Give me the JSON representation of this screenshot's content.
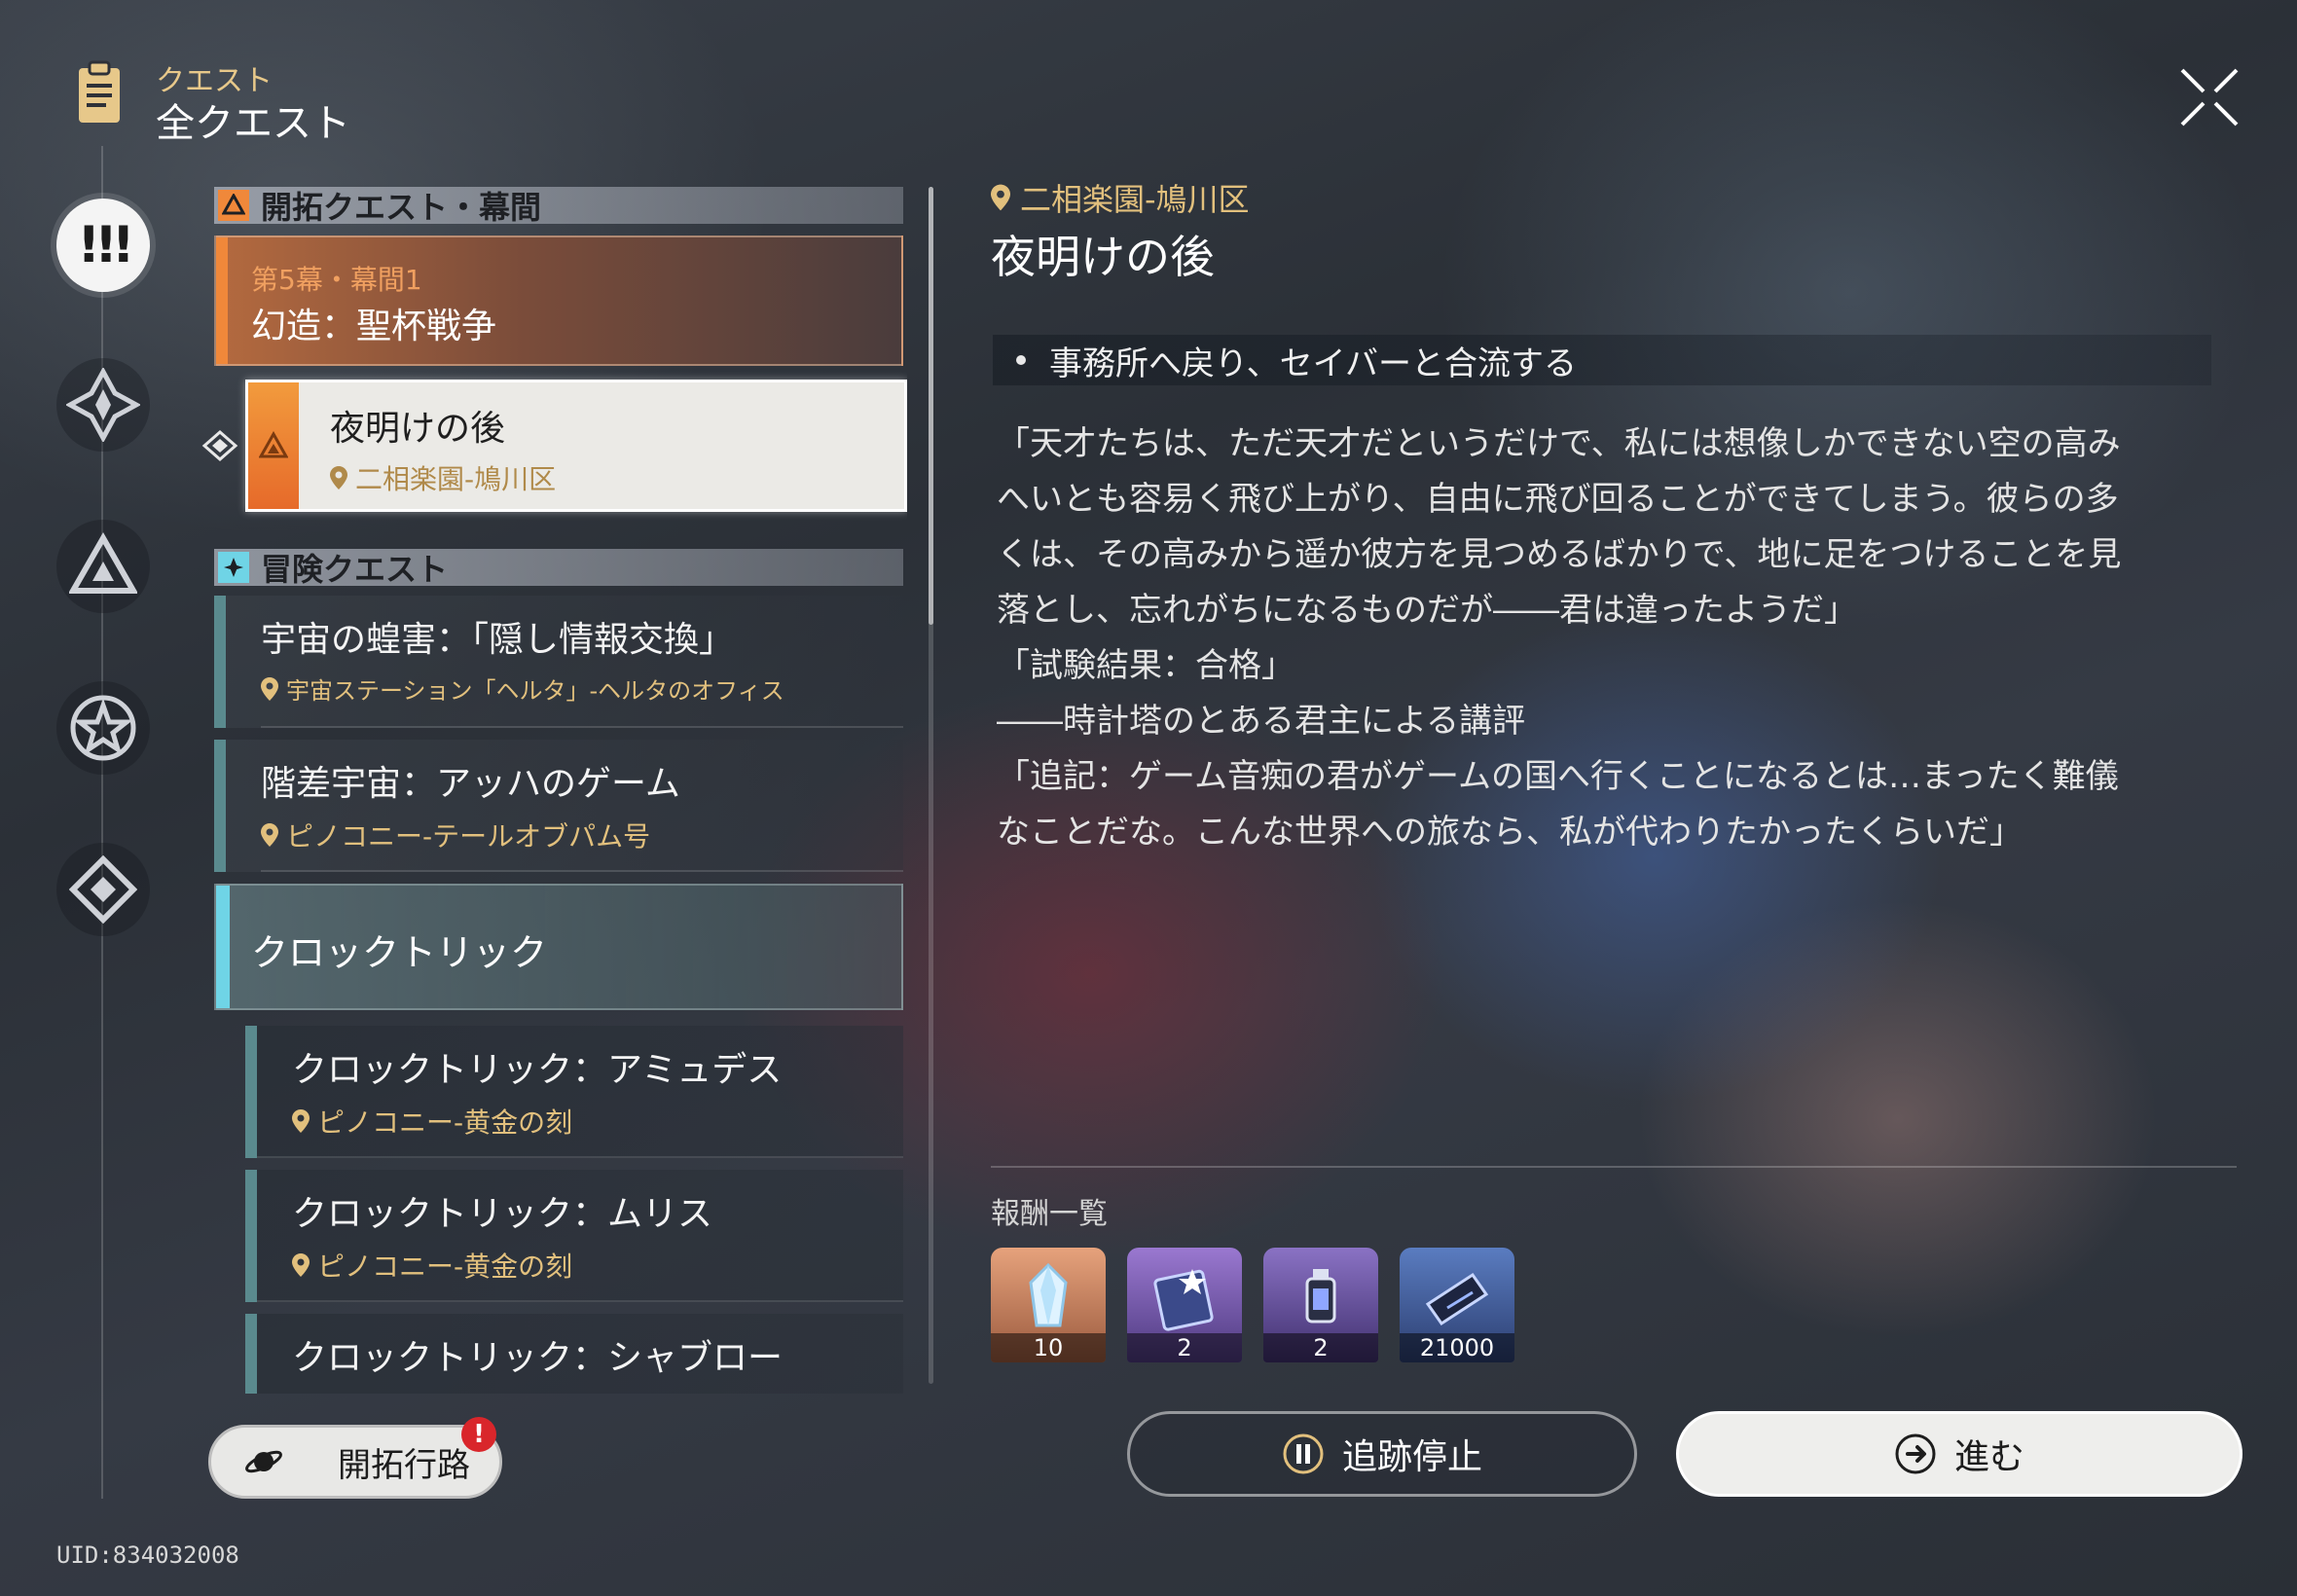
{
  "header": {
    "subtitle": "クエスト",
    "title": "全クエスト"
  },
  "sidebar": {
    "tabs": [
      {
        "name": "all-quests",
        "active": true,
        "icon": "exclamation-icon"
      },
      {
        "name": "trailblaze",
        "active": false,
        "icon": "diamond-star-icon"
      },
      {
        "name": "companion",
        "active": false,
        "icon": "triangle-icon"
      },
      {
        "name": "adventure",
        "active": false,
        "icon": "star-icon"
      },
      {
        "name": "daily",
        "active": false,
        "icon": "diamond-icon"
      }
    ]
  },
  "quest_list": {
    "sections": [
      {
        "label": "開拓クエスト・幕間",
        "color": "#f0883a"
      },
      {
        "label": "冒険クエスト",
        "color": "#6fd4e6"
      }
    ],
    "chapter": {
      "subtitle": "第5幕・幕間1",
      "title": "幻造：聖杯戦争"
    },
    "selected": {
      "title": "夜明けの後",
      "location": "二相楽園-鳩川区"
    },
    "items": [
      {
        "title": "宇宙の蝗害：「隠し情報交換」",
        "location": "宇宙ステーション「ヘルタ」-ヘルタのオフィス"
      },
      {
        "title": "階差宇宙：アッハのゲーム",
        "location": "ピノコニー-テールオブパム号"
      }
    ],
    "group": {
      "title": "クロックトリック"
    },
    "sub_items": [
      {
        "title": "クロックトリック：アミュデス",
        "location": "ピノコニー-黄金の刻"
      },
      {
        "title": "クロックトリック：ムリス",
        "location": "ピノコニー-黄金の刻"
      },
      {
        "title": "クロックトリック：シャブロー",
        "location": ""
      }
    ]
  },
  "footer": {
    "pathway_label": "開拓行路",
    "pathway_alert": "!",
    "uid": "UID:834032008"
  },
  "detail": {
    "location": "二相楽園-鳩川区",
    "title": "夜明けの後",
    "objective": "事務所へ戻り、セイバーと合流する",
    "description": [
      "「天才たちは、ただ天才だというだけで、私には想像しかできない空の高み",
      "へいとも容易く飛び上がり、自由に飛び回ることができてしまう。彼らの多",
      "くは、その高みから遥か彼方を見つめるばかりで、地に足をつけることを見",
      "落とし、忘れがちになるものだが――君は違ったようだ」",
      "「試験結果：合格」",
      "――時計塔のとある君主による講評",
      "「追記：ゲーム音痴の君がゲームの国へ行くことになるとは…まったく難儀",
      "なことだな。こんな世界への旅なら、私が代わりたかったくらいだ」"
    ],
    "rewards_label": "報酬一覧",
    "rewards": [
      {
        "count": "10",
        "icon": "crystal-icon",
        "rarity_color": "#c9805a"
      },
      {
        "count": "2",
        "icon": "exp-book-icon",
        "rarity_color": "#7d5bb0"
      },
      {
        "count": "2",
        "icon": "lantern-icon",
        "rarity_color": "#6a55a0"
      },
      {
        "count": "21000",
        "icon": "credit-icon",
        "rarity_color": "#3f5f9a"
      }
    ],
    "stop_label": "追跡停止",
    "go_label": "進む"
  },
  "colors": {
    "accent_gold": "#e2c07d",
    "trailblaze_orange": "#f0883a",
    "adventure_cyan": "#6fd4e6",
    "alert_red": "#d9262b"
  }
}
